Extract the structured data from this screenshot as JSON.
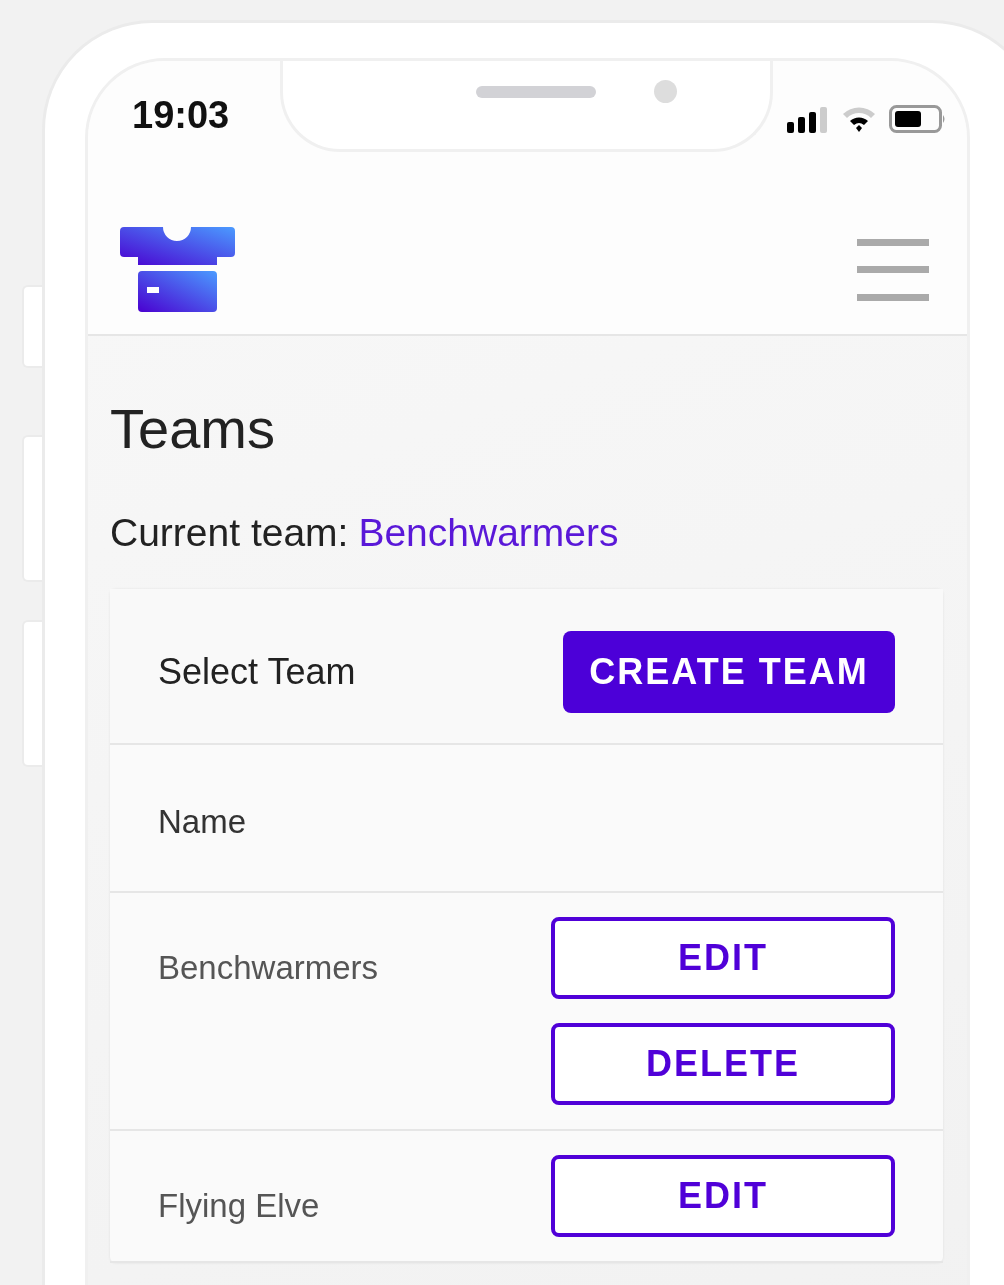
{
  "status_bar": {
    "time": "19:03"
  },
  "page": {
    "title": "Teams",
    "current_team_label": "Current team:",
    "current_team": "Benchwarmers"
  },
  "card": {
    "title": "Select Team",
    "create_button": "CREATE TEAM",
    "column_header": "Name",
    "rows": [
      {
        "name": "Benchwarmers",
        "buttons": [
          "EDIT",
          "DELETE"
        ]
      },
      {
        "name": "Flying Elve",
        "buttons": [
          "EDIT"
        ]
      }
    ]
  }
}
